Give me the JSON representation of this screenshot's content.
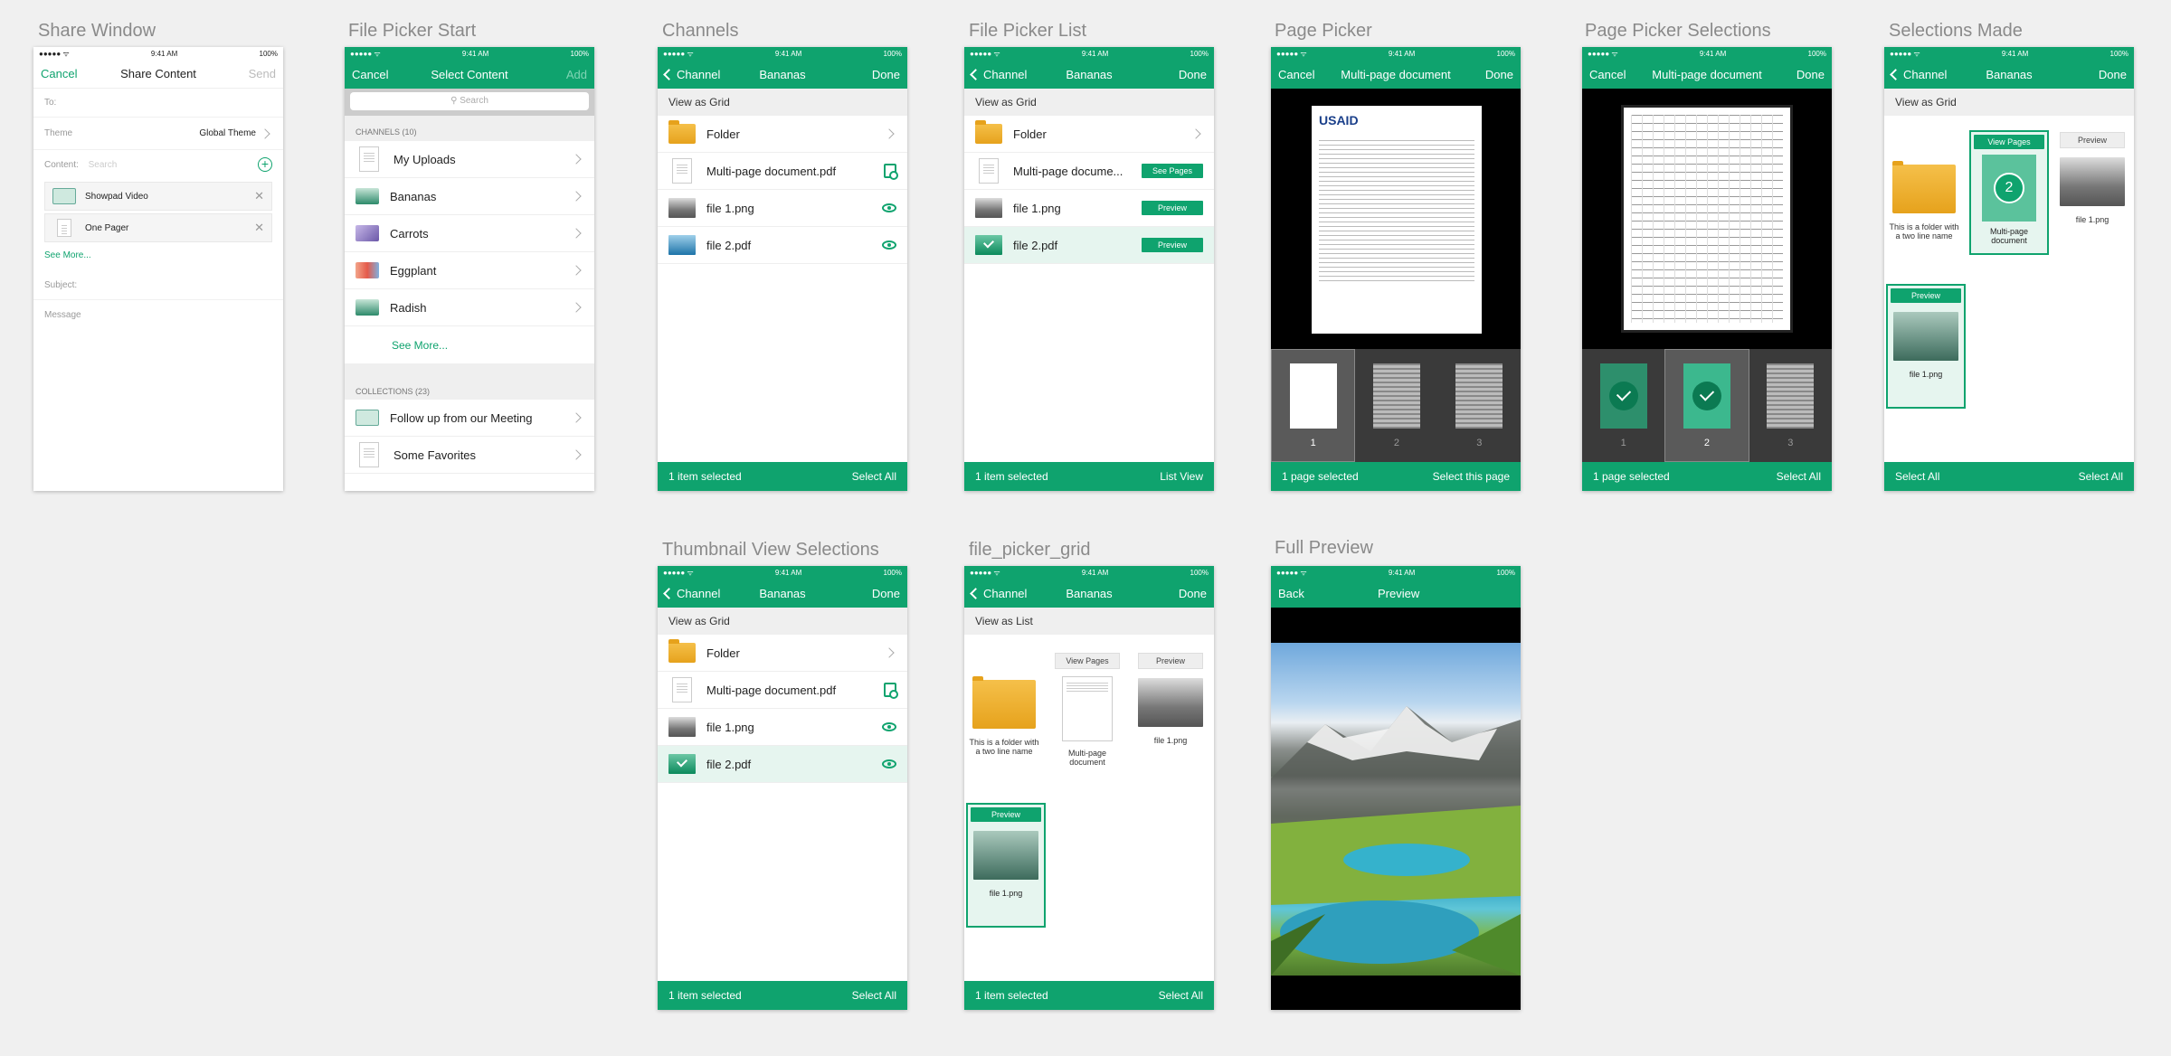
{
  "common": {
    "time": "9:41 AM",
    "battery": "100%",
    "signal": "●●●●● ᯤ",
    "channel_back": "Channel",
    "bananas": "Bananas",
    "done": "Done",
    "cancel": "Cancel",
    "view_as_grid": "View as Grid",
    "view_as_list": "View as List",
    "item_selected": "1 item selected",
    "select_all": "Select All",
    "folder": "Folder",
    "multipage": "Multi-page document.pdf",
    "multipage_short": "Multi-page docume...",
    "file1": "file 1.png",
    "file2": "file 2.pdf",
    "see_pages": "See Pages",
    "preview": "Preview",
    "view_pages": "View Pages",
    "folder_long": "This is a folder with a two line name",
    "multipage_grid": "Multi-page document",
    "multi_page_doc": "Multi-page document",
    "page_selected": "1 page selected"
  },
  "labels": {
    "share_window": "Share Window",
    "file_picker_start": "File Picker Start",
    "channels": "Channels",
    "file_picker_list": "File Picker List",
    "page_picker": "Page Picker",
    "page_picker_selections": "Page Picker Selections",
    "selections_made": "Selections Made",
    "thumbnail_view_selections": "Thumbnail View Selections",
    "file_picker_grid": "file_picker_grid",
    "full_preview": "Full Preview"
  },
  "share": {
    "cancel": "Cancel",
    "title": "Share Content",
    "send": "Send",
    "to": "To:",
    "theme": "Theme",
    "theme_value": "Global Theme",
    "content": "Content:",
    "search": "Search",
    "chip1": "Showpad Video",
    "chip2": "One Pager",
    "see_more": "See More...",
    "subject": "Subject:",
    "message": "Message"
  },
  "picker_start": {
    "cancel": "Cancel",
    "title": "Select Content",
    "add": "Add",
    "search": "Search",
    "channels_header": "CHANNELS (10)",
    "channels": [
      "My Uploads",
      "Bananas",
      "Carrots",
      "Eggplant",
      "Radish"
    ],
    "see_more": "See More...",
    "collections_header": "COLLECTIONS (23)",
    "collections": [
      "Follow up from our Meeting",
      "Some Favorites"
    ]
  },
  "file_picker_list": {
    "list_view": "List View"
  },
  "page_picker": {
    "title": "Multi-page document",
    "select_this_page": "Select this page",
    "pages": [
      "1",
      "2",
      "3"
    ],
    "letterhead": "USAID"
  },
  "full_preview": {
    "back": "Back",
    "title": "Preview"
  },
  "selected_badge": "2",
  "colors": {
    "accent": "#0fa36e",
    "selected_bg": "#e6f5ef"
  }
}
